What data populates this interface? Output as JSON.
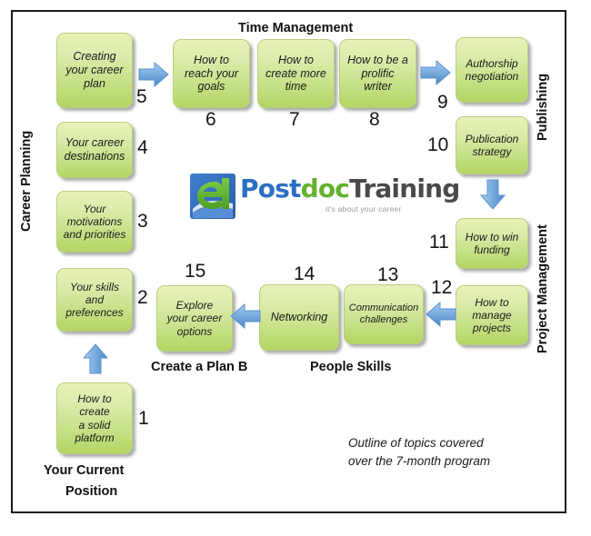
{
  "diagram": {
    "title": "Outline of topics covered over the 7-month program",
    "accent_green": "#b4d564",
    "accent_blue": "#6a9fd8",
    "frame_color": "#1a1a1a"
  },
  "section_labels": {
    "time_management": "Time Management",
    "career_planning": "Career Planning",
    "publishing": "Publishing",
    "project_management": "Project Management",
    "people_skills": "People Skills",
    "create_a_plan_b": "Create a Plan B",
    "your_current_position_line1": "Your Current",
    "your_current_position_line2": "Position"
  },
  "note": {
    "line1": "Outline of topics covered",
    "line2": "over the 7-month program"
  },
  "logo": {
    "word_post": "Postdoc",
    "word_part_blue": "Post",
    "word_part_green": "doc",
    "word_part_gray": "Training",
    "tagline": "it's about your career"
  },
  "steps": [
    {
      "number": "1",
      "lines": [
        "How to",
        "create",
        "a solid",
        "platform"
      ]
    },
    {
      "number": "2",
      "lines": [
        "Your skills",
        "and",
        "preferences"
      ]
    },
    {
      "number": "3",
      "lines": [
        "Your",
        "motivations",
        "and priorities"
      ]
    },
    {
      "number": "4",
      "lines": [
        "Your career",
        "destinations"
      ]
    },
    {
      "number": "5",
      "lines": [
        "Creating",
        "your career",
        "plan"
      ]
    },
    {
      "number": "6",
      "lines": [
        "How to",
        "reach your",
        "goals"
      ]
    },
    {
      "number": "7",
      "lines": [
        "How to",
        "create more",
        "time"
      ]
    },
    {
      "number": "8",
      "lines": [
        "How to be a",
        "prolific",
        "writer"
      ]
    },
    {
      "number": "9",
      "lines": [
        "Authorship",
        "negotiation"
      ]
    },
    {
      "number": "10",
      "lines": [
        "Publication",
        "strategy"
      ]
    },
    {
      "number": "11",
      "lines": [
        "How to win",
        "funding"
      ]
    },
    {
      "number": "12",
      "lines": [
        "How to",
        "manage",
        "projects"
      ]
    },
    {
      "number": "13",
      "lines": [
        "Communication",
        "challenges"
      ]
    },
    {
      "number": "14",
      "lines": [
        "Networking"
      ]
    },
    {
      "number": "15",
      "lines": [
        "Explore",
        "your career",
        "options"
      ]
    }
  ],
  "arrows": [
    {
      "name": "arrow-5-to-6",
      "direction": "right"
    },
    {
      "name": "arrow-8-to-9",
      "direction": "right"
    },
    {
      "name": "arrow-10-to-11",
      "direction": "down"
    },
    {
      "name": "arrow-12-to-13",
      "direction": "left"
    },
    {
      "name": "arrow-14-to-15",
      "direction": "left"
    },
    {
      "name": "arrow-1-to-2",
      "direction": "up"
    }
  ]
}
